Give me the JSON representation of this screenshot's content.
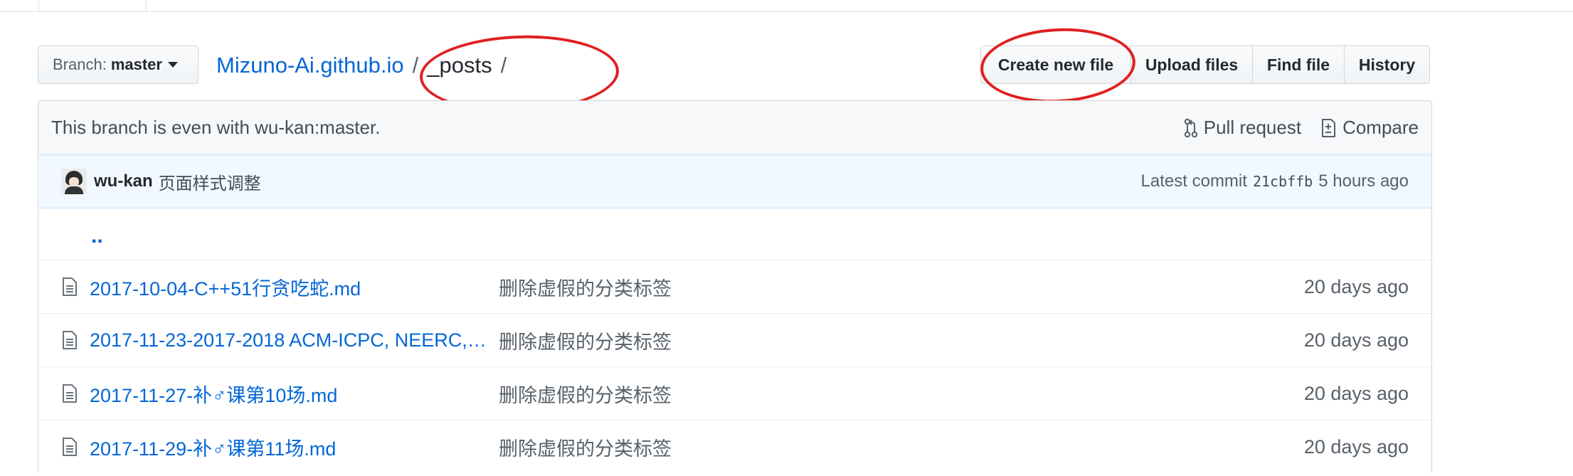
{
  "branch": {
    "prefix": "Branch:",
    "name": "master"
  },
  "breadcrumb": {
    "repo": "Mizuno-Ai.github.io",
    "sep1": "/",
    "current": "_posts",
    "sep2": "/"
  },
  "file_nav": {
    "create_new_file": "Create new file",
    "upload_files": "Upload files",
    "find_file": "Find file",
    "history": "History"
  },
  "branch_info": {
    "message": "This branch is even with wu-kan:master.",
    "pull_request": "Pull request",
    "compare": "Compare"
  },
  "latest_commit": {
    "author": "wu-kan",
    "message": "页面样式调整",
    "label": "Latest commit",
    "sha": "21cbffb",
    "age": "5 hours ago"
  },
  "files": {
    "up_dir": "..",
    "rows": [
      {
        "name": "2017-10-04-C++51行贪吃蛇.md",
        "message": "删除虚假的分类标签",
        "age": "20 days ago"
      },
      {
        "name": "2017-11-23-2017-2018 ACM-ICPC, NEERC,…",
        "message": "删除虚假的分类标签",
        "age": "20 days ago"
      },
      {
        "name": "2017-11-27-补♂课第10场.md",
        "message": "删除虚假的分类标签",
        "age": "20 days ago"
      },
      {
        "name": "2017-11-29-补♂课第11场.md",
        "message": "删除虚假的分类标签",
        "age": "20 days ago"
      }
    ]
  },
  "colors": {
    "link": "#0366d6",
    "annotation": "#e02020",
    "commit_bg": "#f1f8ff",
    "info_bg": "#f6f8fa"
  },
  "icons": [
    "caret-down-icon",
    "pull-request-icon",
    "compare-icon",
    "file-icon"
  ]
}
